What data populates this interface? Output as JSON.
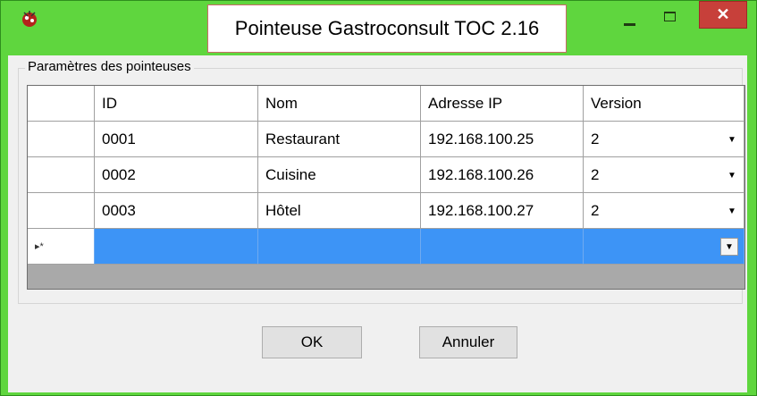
{
  "window": {
    "title": "Pointeuse Gastroconsult TOC 2.16",
    "close_glyph": "✕",
    "icon": "app-logo-icon"
  },
  "group": {
    "label": "Paramètres des pointeuses"
  },
  "grid": {
    "columns": [
      "ID",
      "Nom",
      "Adresse IP",
      "Version"
    ],
    "rows": [
      {
        "id": "0001",
        "name": "Restaurant",
        "ip": "192.168.100.25",
        "version": "2"
      },
      {
        "id": "0002",
        "name": "Cuisine",
        "ip": "192.168.100.26",
        "version": "2"
      },
      {
        "id": "0003",
        "name": "Hôtel",
        "ip": "192.168.100.27",
        "version": "2"
      }
    ],
    "new_row_marker": "▸*",
    "dropdown_glyph": "▼"
  },
  "buttons": {
    "ok": "OK",
    "cancel": "Annuler"
  },
  "colors": {
    "frame": "#5fd63e",
    "close": "#c7403a",
    "selection": "#3d94f6"
  }
}
